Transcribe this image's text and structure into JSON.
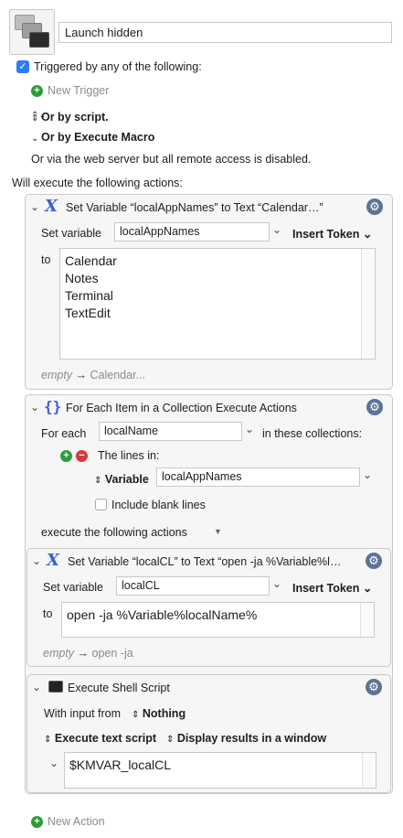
{
  "macro": {
    "name": "Launch hidden"
  },
  "triggers": {
    "header": "Triggered by any of the following:",
    "new_trigger": "New Trigger",
    "or_by_script": "Or by script.",
    "or_by_execute_macro": "Or by Execute Macro",
    "web_server_note": "Or via the web server but all remote access is disabled."
  },
  "actions_header": "Will execute the following actions:",
  "action1": {
    "title": "Set Variable “localAppNames” to Text “Calendar…”",
    "set_variable_label": "Set variable",
    "variable_value": "localAppNames",
    "insert_token": "Insert Token",
    "to_label": "to",
    "text_lines": [
      "Calendar",
      "Notes",
      "Terminal",
      "TextEdit"
    ],
    "footer_empty": "empty",
    "footer_arrow": "→",
    "footer_value": "Calendar..."
  },
  "action2": {
    "title": "For Each Item in a Collection Execute Actions",
    "for_each_label": "For each",
    "item_variable": "localName",
    "in_collections": "in these collections:",
    "lines_in": "The lines in:",
    "variable_kind": "Variable",
    "collection_variable": "localAppNames",
    "include_blank": "Include blank lines",
    "execute_following": "execute the following actions",
    "nested": {
      "title": "Set Variable “localCL” to Text “open -ja %Variable%l…",
      "set_variable_label": "Set variable",
      "variable_value": "localCL",
      "insert_token": "Insert Token",
      "to_label": "to",
      "text_value": "open -ja %Variable%localName%",
      "footer_empty": "empty",
      "footer_arrow": "→",
      "footer_value": "open -ja"
    }
  },
  "action3": {
    "title": "Execute Shell Script",
    "with_input_label": "With input from",
    "input_source": "Nothing",
    "execute_mode": "Execute text script",
    "display_mode": "Display results in a window",
    "script_text": "$KMVAR_localCL"
  },
  "new_action": "New Action",
  "icons": {
    "checkbox": "checkmark-icon",
    "gear": "gear-icon",
    "variable": "x-variable-icon",
    "for_each": "curly-braces-icon",
    "terminal": "terminal-icon"
  }
}
